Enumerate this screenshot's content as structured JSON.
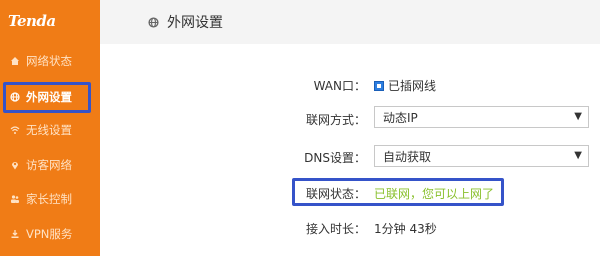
{
  "brand": {
    "logo_text": "Tenda"
  },
  "sidebar": {
    "items": [
      {
        "label": "网络状态",
        "icon": "house-icon"
      },
      {
        "label": "外网设置",
        "icon": "globe-icon",
        "active": true
      },
      {
        "label": "无线设置",
        "icon": "wifi-icon"
      },
      {
        "label": "访客网络",
        "icon": "location-pin-icon"
      },
      {
        "label": "家长控制",
        "icon": "people-icon"
      },
      {
        "label": "VPN服务",
        "icon": "vpn-icon"
      }
    ]
  },
  "header": {
    "title": "外网设置",
    "icon": "globe-icon"
  },
  "form": {
    "wan_label": "WAN口：",
    "wan_value": "已插网线",
    "connection_type_label": "联网方式：",
    "connection_type_value": "动态IP",
    "dns_label": "DNS设置：",
    "dns_value": "自动获取",
    "status_label": "联网状态：",
    "status_value": "已联网，您可以上网了",
    "uptime_label": "接入时长：",
    "uptime_value": "1分钟 43秒"
  },
  "colors": {
    "sidebar_bg": "#f07c16",
    "highlight_border": "#3553c9",
    "status_ok": "#89c02d"
  }
}
